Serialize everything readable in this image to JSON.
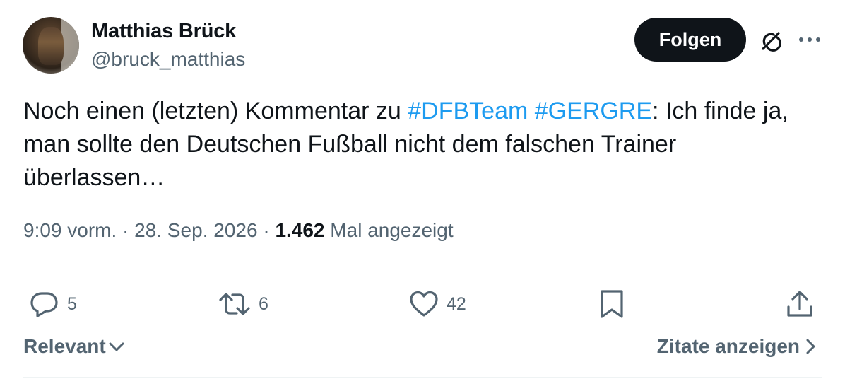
{
  "author": {
    "name": "Matthias Brück",
    "handle": "@bruck_matthias",
    "avatar_icon": "avatar-photo"
  },
  "follow_button": {
    "label": "Folgen"
  },
  "header_icons": [
    "grok-icon",
    "more-icon"
  ],
  "tweet": {
    "segments": [
      {
        "text": "Noch einen (letzten) Kommentar zu ",
        "type": "text"
      },
      {
        "text": "#DFBTeam",
        "type": "hashtag"
      },
      {
        "text": " ",
        "type": "text"
      },
      {
        "text": "#GERGRE",
        "type": "hashtag"
      },
      {
        "text": ": Ich finde ja, man sollte den Deutschen Fußball nicht dem falschen Trainer überlassen…",
        "type": "text"
      }
    ]
  },
  "meta": {
    "time": "9:09 vorm.",
    "separator1": " · ",
    "date": "28. Sep. 2026",
    "separator2": " · ",
    "views_count": "1.462",
    "views_label": " Mal angezeigt"
  },
  "actions": {
    "reply": {
      "icon": "reply-icon",
      "count": "5"
    },
    "retweet": {
      "icon": "retweet-icon",
      "count": "6"
    },
    "like": {
      "icon": "heart-icon",
      "count": "42"
    },
    "bookmark": {
      "icon": "bookmark-icon"
    },
    "share": {
      "icon": "share-icon"
    }
  },
  "footer": {
    "sort_label": "Relevant",
    "quotes_label": "Zitate anzeigen"
  },
  "colors": {
    "text": "#0f1419",
    "secondary": "#536471",
    "link": "#1d9bf0",
    "divider": "#eff3f4",
    "button_bg": "#0f1419"
  }
}
